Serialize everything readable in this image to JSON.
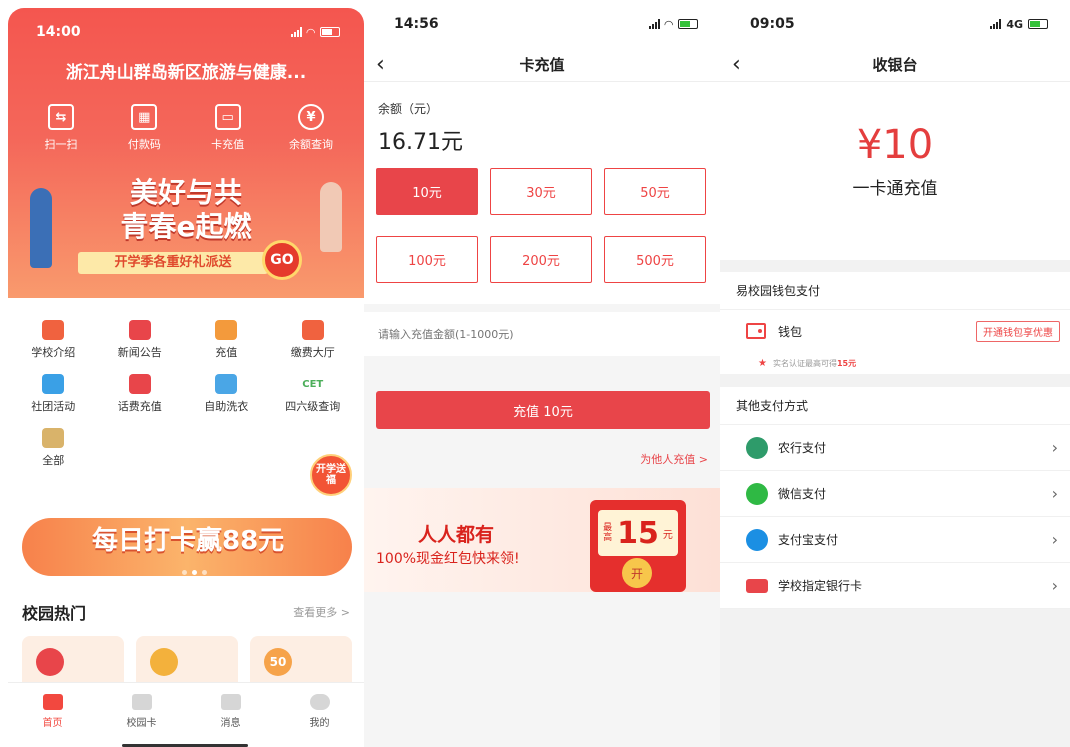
{
  "phone1": {
    "status": {
      "time": "14:00"
    },
    "title": "浙江舟山群岛新区旅游与健康...",
    "quick_actions": [
      "扫一扫",
      "付款码",
      "卡充值",
      "余额查询"
    ],
    "banner": {
      "headline_1": "美好与共",
      "headline_2": "青春e起燃",
      "ribbon": "开学季各重好礼派送",
      "go": "GO"
    },
    "services": [
      {
        "label": "学校介绍",
        "icon": "school-icon",
        "color": "#f0623f"
      },
      {
        "label": "新闻公告",
        "icon": "news-icon",
        "color": "#e8454a"
      },
      {
        "label": "充值",
        "icon": "recharge-icon",
        "color": "#f39a3c"
      },
      {
        "label": "缴费大厅",
        "icon": "payment-hall-icon",
        "color": "#f0623f"
      },
      {
        "label": "社团活动",
        "icon": "flag-icon",
        "color": "#3aa0e6"
      },
      {
        "label": "话费充值",
        "icon": "phone-bill-icon",
        "color": "#e8454a"
      },
      {
        "label": "自助洗衣",
        "icon": "washing-machine-icon",
        "color": "#4aa6e6"
      },
      {
        "label": "四六级查询",
        "icon": "cet-icon",
        "color": "#4cae5a",
        "text": "CET"
      },
      {
        "label": "全部",
        "icon": "grid-all-icon",
        "color": "#d9b36a"
      }
    ],
    "promo": {
      "text": "每日打卡赢88元",
      "badge": "开学送福"
    },
    "hot": {
      "title": "校园热门",
      "more": "查看更多 >",
      "card_value": "50"
    },
    "tabs": [
      "首页",
      "校园卡",
      "消息",
      "我的"
    ]
  },
  "phone2": {
    "status": {
      "time": "14:56"
    },
    "nav_title": "卡充值",
    "balance_label": "余额（元）",
    "balance_value": "16.71元",
    "amounts": [
      "10元",
      "30元",
      "50元",
      "100元",
      "200元",
      "500元"
    ],
    "selected_index": 0,
    "custom_placeholder": "请输入充值金额(1-1000元)",
    "charge_button": "充值 10元",
    "other_link": "为他人充值 >",
    "banner": {
      "line1": "人人都有",
      "line2": "100%现金红包快来领!",
      "max_label": "最高",
      "amount": "15",
      "unit": "元",
      "open": "开"
    }
  },
  "phone3": {
    "status": {
      "time": "09:05",
      "network": "4G"
    },
    "nav_title": "收银台",
    "amount": "¥10",
    "desc": "一卡通充值",
    "wallet_section": "易校园钱包支付",
    "wallet_name": "钱包",
    "wallet_promo": "开通钱包享优惠",
    "wallet_tip_prefix": "实名认证最高可得",
    "wallet_tip_value": "15元",
    "other_section": "其他支付方式",
    "methods": [
      {
        "label": "农行支付",
        "icon": "abc-bank-icon",
        "color": "#2e9b6a"
      },
      {
        "label": "微信支付",
        "icon": "wechat-icon",
        "color": "#2fb944"
      },
      {
        "label": "支付宝支付",
        "icon": "alipay-icon",
        "color": "#1b8fe3"
      },
      {
        "label": "学校指定银行卡",
        "icon": "bank-card-icon",
        "color": "#e8454a"
      }
    ]
  }
}
